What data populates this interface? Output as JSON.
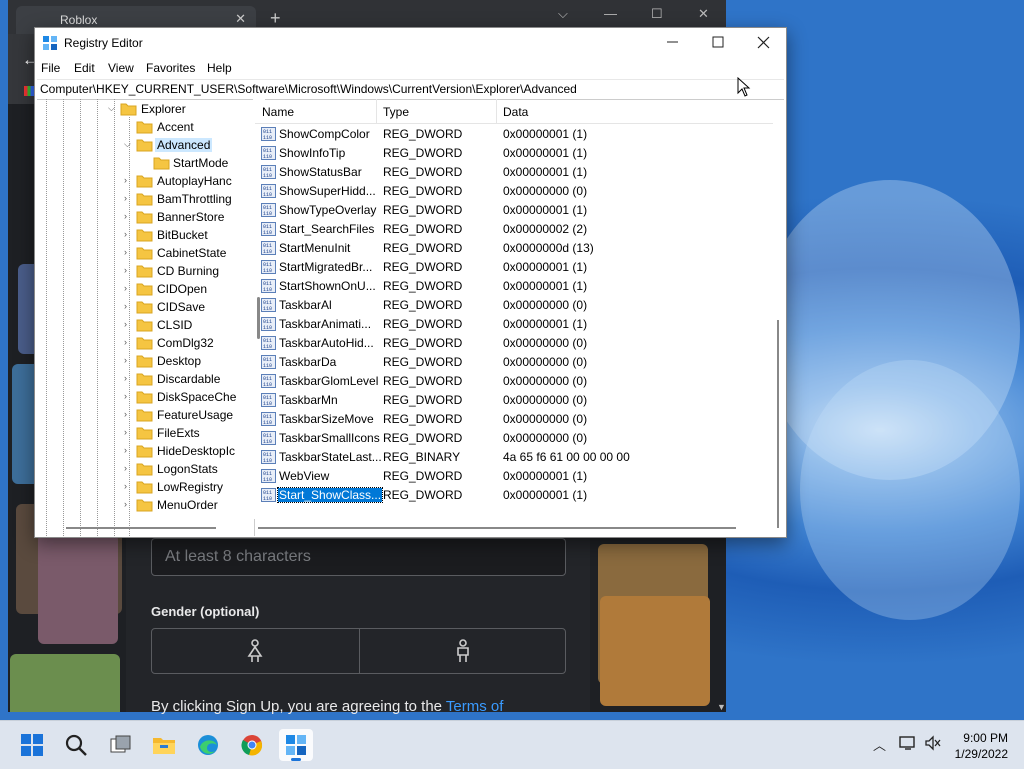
{
  "browser": {
    "tab_title": "Roblox",
    "password_placeholder": "At least 8 characters",
    "gender_label": "Gender (optional)",
    "terms_text": "By clicking Sign Up, you are agreeing to the ",
    "terms_link": "Terms of"
  },
  "regedit": {
    "title": "Registry Editor",
    "menu": [
      "File",
      "Edit",
      "View",
      "Favorites",
      "Help"
    ],
    "address": "Computer\\HKEY_CURRENT_USER\\Software\\Microsoft\\Windows\\CurrentVersion\\Explorer\\Advanced",
    "tree": {
      "explorer": "Explorer",
      "accent": "Accent",
      "advanced": "Advanced",
      "startmode": "StartMode",
      "children": [
        "AutoplayHanc",
        "BamThrottling",
        "BannerStore",
        "BitBucket",
        "CabinetState",
        "CD Burning",
        "CIDOpen",
        "CIDSave",
        "CLSID",
        "ComDlg32",
        "Desktop",
        "Discardable",
        "DiskSpaceChe",
        "FeatureUsage",
        "FileExts",
        "HideDesktopIc",
        "LogonStats",
        "LowRegistry",
        "MenuOrder"
      ]
    },
    "columns": {
      "name": "Name",
      "type": "Type",
      "data": "Data"
    },
    "values": [
      {
        "name": "ShowCompColor",
        "type": "REG_DWORD",
        "data": "0x00000001 (1)"
      },
      {
        "name": "ShowInfoTip",
        "type": "REG_DWORD",
        "data": "0x00000001 (1)"
      },
      {
        "name": "ShowStatusBar",
        "type": "REG_DWORD",
        "data": "0x00000001 (1)"
      },
      {
        "name": "ShowSuperHidd...",
        "type": "REG_DWORD",
        "data": "0x00000000 (0)"
      },
      {
        "name": "ShowTypeOverlay",
        "type": "REG_DWORD",
        "data": "0x00000001 (1)"
      },
      {
        "name": "Start_SearchFiles",
        "type": "REG_DWORD",
        "data": "0x00000002 (2)"
      },
      {
        "name": "StartMenuInit",
        "type": "REG_DWORD",
        "data": "0x0000000d (13)"
      },
      {
        "name": "StartMigratedBr...",
        "type": "REG_DWORD",
        "data": "0x00000001 (1)"
      },
      {
        "name": "StartShownOnU...",
        "type": "REG_DWORD",
        "data": "0x00000001 (1)"
      },
      {
        "name": "TaskbarAl",
        "type": "REG_DWORD",
        "data": "0x00000000 (0)"
      },
      {
        "name": "TaskbarAnimati...",
        "type": "REG_DWORD",
        "data": "0x00000001 (1)"
      },
      {
        "name": "TaskbarAutoHid...",
        "type": "REG_DWORD",
        "data": "0x00000000 (0)"
      },
      {
        "name": "TaskbarDa",
        "type": "REG_DWORD",
        "data": "0x00000000 (0)"
      },
      {
        "name": "TaskbarGlomLevel",
        "type": "REG_DWORD",
        "data": "0x00000000 (0)"
      },
      {
        "name": "TaskbarMn",
        "type": "REG_DWORD",
        "data": "0x00000000 (0)"
      },
      {
        "name": "TaskbarSizeMove",
        "type": "REG_DWORD",
        "data": "0x00000000 (0)"
      },
      {
        "name": "TaskbarSmallIcons",
        "type": "REG_DWORD",
        "data": "0x00000000 (0)"
      },
      {
        "name": "TaskbarStateLast...",
        "type": "REG_BINARY",
        "data": "4a 65 f6 61 00 00 00 00"
      },
      {
        "name": "WebView",
        "type": "REG_DWORD",
        "data": "0x00000001 (1)"
      },
      {
        "name": "Start_ShowClass...",
        "type": "REG_DWORD",
        "data": "0x00000001 (1)",
        "selected": true
      }
    ]
  },
  "taskbar": {
    "apps": [
      "start-icon",
      "search-icon",
      "task-view-icon",
      "file-explorer-icon",
      "edge-icon",
      "chrome-icon",
      "regedit-icon"
    ],
    "time": "9:00 PM",
    "date": "1/29/2022"
  },
  "colors": {
    "accent": "#0078d7",
    "link": "#3a9bff"
  }
}
